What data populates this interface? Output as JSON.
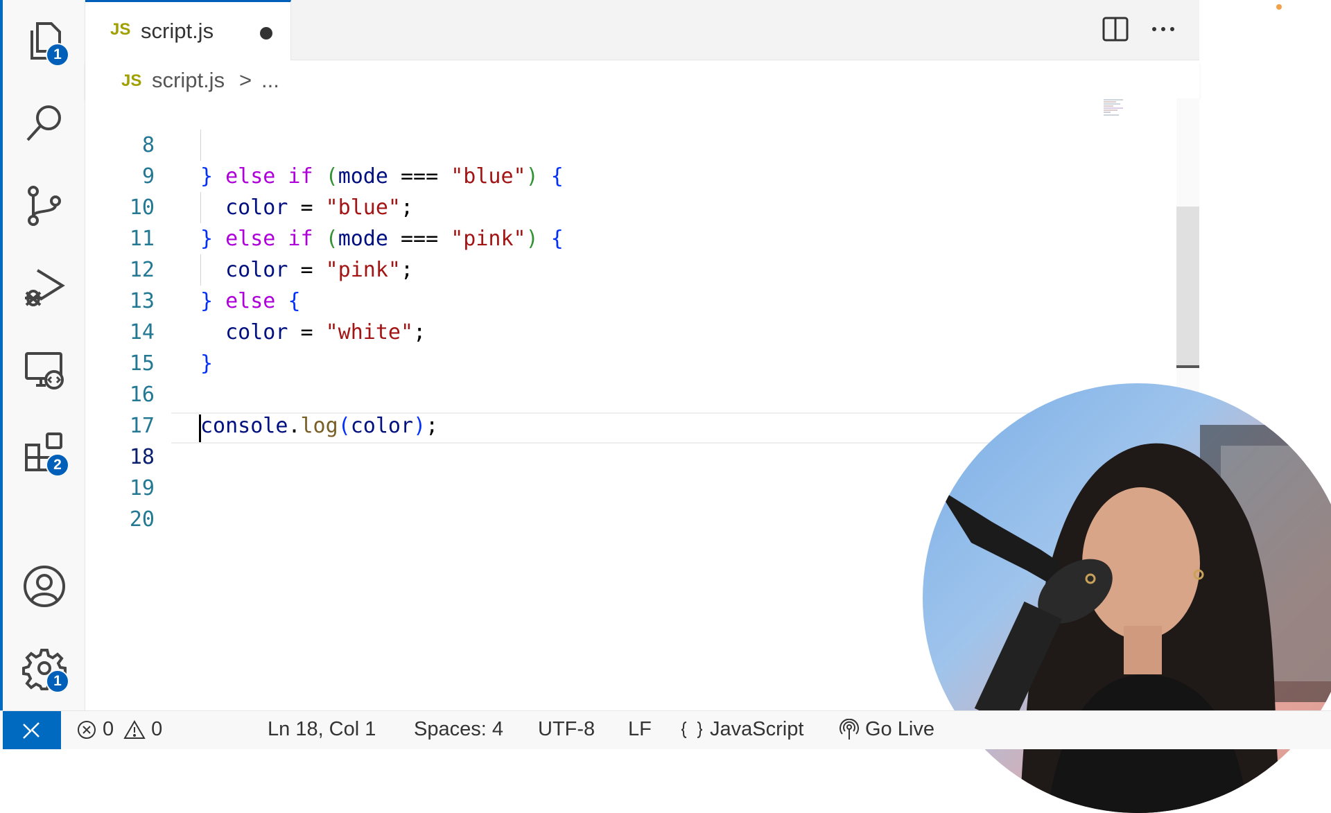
{
  "activity_bar": {
    "explorer_badge": "1",
    "extensions_badge": "2",
    "settings_badge": "1"
  },
  "tab": {
    "lang_badge": "JS",
    "filename": "script.js"
  },
  "breadcrumb": {
    "lang_badge": "JS",
    "file": "script.js",
    "separator": ">",
    "more": "..."
  },
  "editor": {
    "lines": [
      {
        "num": "8"
      },
      {
        "num": "9"
      },
      {
        "num": "10"
      },
      {
        "num": "11"
      },
      {
        "num": "12"
      },
      {
        "num": "13"
      },
      {
        "num": "14"
      },
      {
        "num": "15"
      },
      {
        "num": "16"
      },
      {
        "num": "17"
      },
      {
        "num": "18"
      },
      {
        "num": "19"
      },
      {
        "num": "20"
      }
    ],
    "tokens": {
      "close_brace": "}",
      "open_brace": "{",
      "else_if": "else if",
      "else": "else",
      "open_paren": "(",
      "close_paren": ")",
      "mode": "mode",
      "strict_eq": "===",
      "assign": "=",
      "color": "color",
      "semicolon": ";",
      "blue": "\"blue\"",
      "pink": "\"pink\"",
      "white": "\"white\"",
      "console": "console",
      "dot": ".",
      "log": "log"
    }
  },
  "status_bar": {
    "errors": "0",
    "warnings": "0",
    "position": "Ln 18, Col 1",
    "spaces": "Spaces: 4",
    "encoding": "UTF-8",
    "eol": "LF",
    "language": "JavaScript",
    "go_live": "Go Live"
  },
  "colors": {
    "accent": "#005fb8",
    "remote": "#0069c0",
    "keyword": "#af00db",
    "string": "#a31515",
    "variable": "#001080",
    "function": "#795e26",
    "line_number": "#237893"
  }
}
